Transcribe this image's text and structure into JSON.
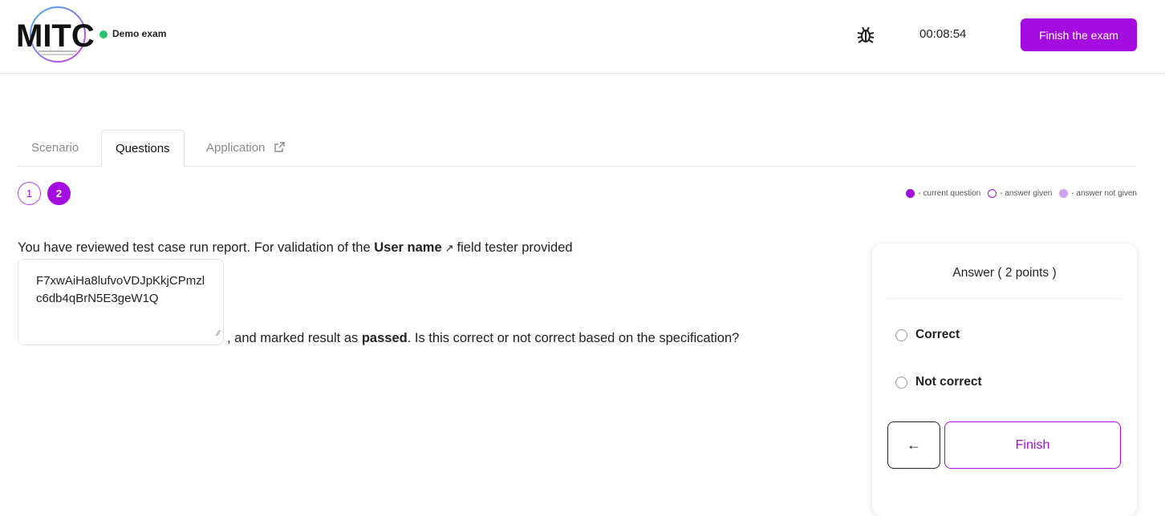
{
  "header": {
    "exam_name": "Demo exam",
    "timer": "00:08:54",
    "finish_exam_label": "Finish the exam",
    "logo_text": "MITC",
    "icons": {
      "bug": "bug-icon"
    }
  },
  "tabs": [
    {
      "label": "Scenario",
      "active": false
    },
    {
      "label": "Questions",
      "active": true
    },
    {
      "label": "Application",
      "active": false,
      "icon": "external-link-icon"
    }
  ],
  "question_nav": {
    "items": [
      {
        "label": "1",
        "state": "answered"
      },
      {
        "label": "2",
        "state": "current"
      }
    ]
  },
  "legend": {
    "current": "- current question",
    "given": "- answer given",
    "not_given": "- answer not given"
  },
  "question": {
    "part1": "You have reviewed test case run report. For validation of the",
    "field_name": "User name",
    "part2": "field tester provided",
    "value": "F7xwAiHa8lufvoVDJpKkjCPmzlc6db4qBrN5E3geW1Q",
    "part3": ", and marked result as",
    "result": "passed",
    "part4": ". Is this correct or not correct based on the specification?"
  },
  "answer_card": {
    "title": "Answer ( 2 points )",
    "options": [
      "Correct",
      "Not correct"
    ],
    "finish_label": "Finish",
    "back_icon": "arrow-left-icon"
  },
  "colors": {
    "accent": "#a40de0",
    "accent_light": "#cfa2f0",
    "status_green": "#27c46b"
  }
}
